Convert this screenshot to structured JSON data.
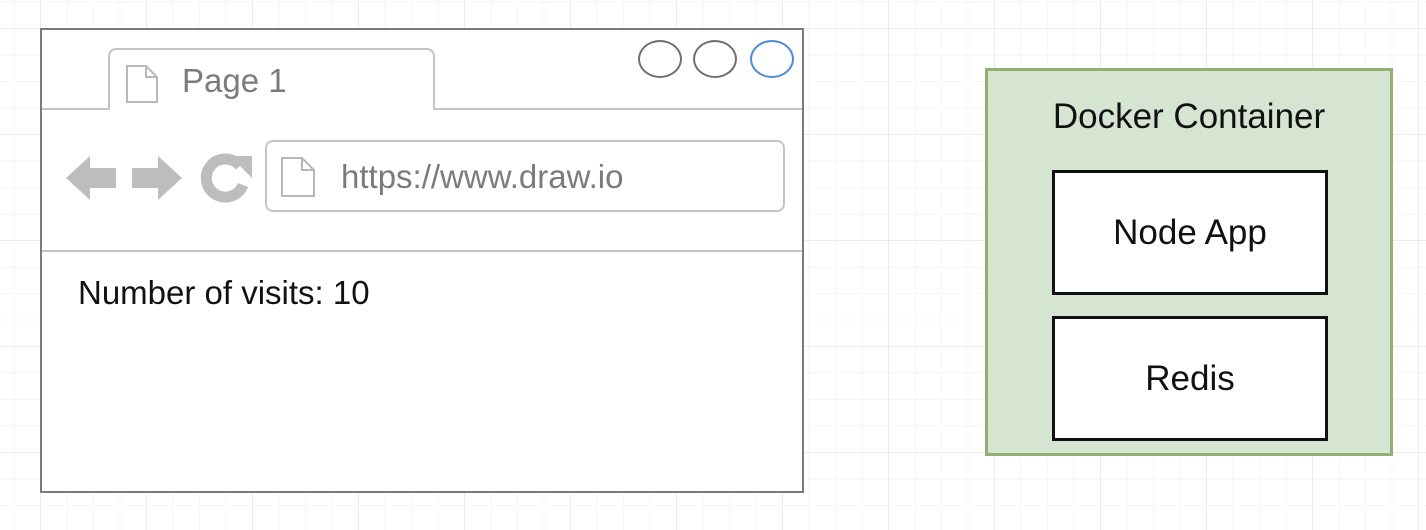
{
  "browser": {
    "tab_label": "Page 1",
    "url": "https://www.draw.io",
    "content_text": "Number of visits: 10",
    "window_buttons": [
      "minimize-button",
      "maximize-button",
      "close-button"
    ]
  },
  "docker": {
    "title": "Docker Container",
    "services": [
      {
        "label": "Node App"
      },
      {
        "label": "Redis"
      }
    ]
  },
  "colors": {
    "container_fill": "#d6e4d2",
    "container_border": "#8fb174",
    "window_accent": "#4a8ad6",
    "chrome_gray": "#c4c4c4"
  },
  "icons": [
    "document-icon",
    "back-arrow-icon",
    "forward-arrow-icon",
    "reload-icon"
  ]
}
